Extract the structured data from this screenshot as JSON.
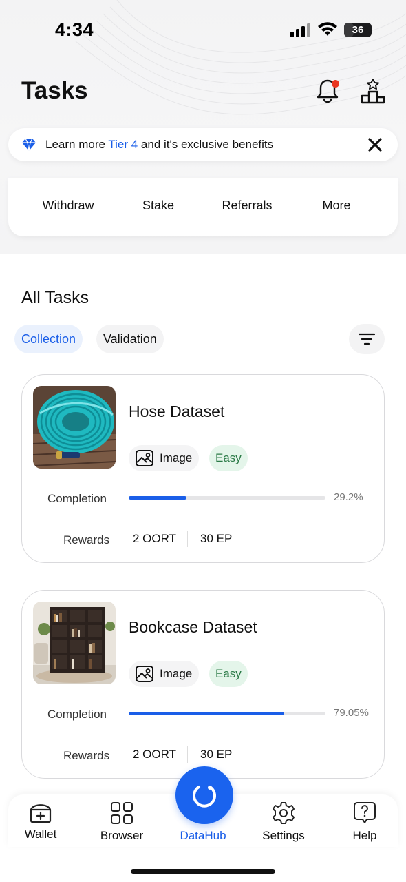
{
  "status_bar": {
    "time": "4:34",
    "battery": "36",
    "battery_level": 0.36
  },
  "header": {
    "title": "Tasks"
  },
  "banner": {
    "prefix": "Learn more ",
    "link": "Tier 4",
    "suffix": " and it's exclusive benefits"
  },
  "quick_actions": [
    "Withdraw",
    "Stake",
    "Referrals",
    "More"
  ],
  "all_tasks": {
    "title": "All Tasks",
    "tabs": [
      {
        "label": "Collection",
        "active": true
      },
      {
        "label": "Validation",
        "active": false
      }
    ]
  },
  "tasks": [
    {
      "title": "Hose Dataset",
      "type": "Image",
      "difficulty": "Easy",
      "completion_label": "Completion",
      "completion": "29.2%",
      "completion_fraction": 0.292,
      "rewards_label": "Rewards",
      "reward_token": "2 OORT",
      "reward_points": "30 EP"
    },
    {
      "title": "Bookcase Dataset",
      "type": "Image",
      "difficulty": "Easy",
      "completion_label": "Completion",
      "completion": "79.05%",
      "completion_fraction": 0.7905,
      "rewards_label": "Rewards",
      "reward_token": "2 OORT",
      "reward_points": "30 EP"
    }
  ],
  "bottom_nav": [
    {
      "label": "Wallet",
      "icon": "wallet-icon",
      "active": false
    },
    {
      "label": "Browser",
      "icon": "grid-icon",
      "active": false
    },
    {
      "label": "DataHub",
      "icon": "datahub-icon",
      "active": true
    },
    {
      "label": "Settings",
      "icon": "gear-icon",
      "active": false
    },
    {
      "label": "Help",
      "icon": "help-icon",
      "active": false
    }
  ],
  "colors": {
    "accent": "#1a5ee8",
    "easy_bg": "#e4f5ea",
    "easy_text": "#2b7a47",
    "notification": "#e9351f"
  }
}
